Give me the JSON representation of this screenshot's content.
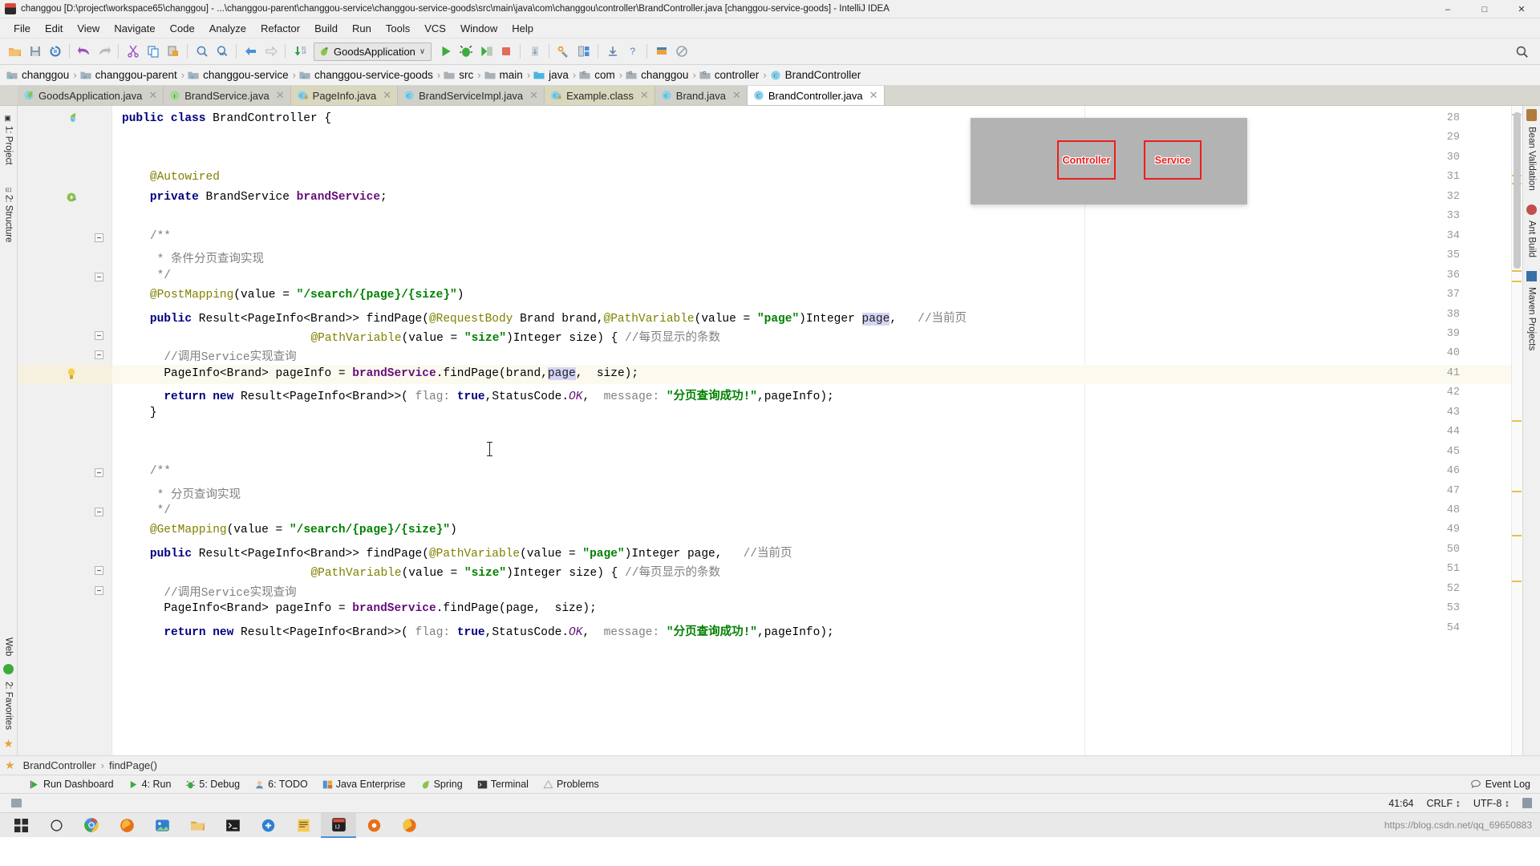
{
  "window": {
    "title": "changgou [D:\\project\\workspace65\\changgou] - ...\\changgou-parent\\changgou-service\\changgou-service-goods\\src\\main\\java\\com\\changgou\\controller\\BrandController.java [changgou-service-goods] - IntelliJ IDEA",
    "minimize": "–",
    "maximize": "□",
    "close": "✕"
  },
  "menu": [
    "File",
    "Edit",
    "View",
    "Navigate",
    "Code",
    "Analyze",
    "Refactor",
    "Build",
    "Run",
    "Tools",
    "VCS",
    "Window",
    "Help"
  ],
  "toolbar": {
    "icons": [
      "open-folder-icon",
      "save-all-icon",
      "sync-icon",
      "undo-icon",
      "redo-icon",
      "cut-icon",
      "copy-icon",
      "paste-icon",
      "find-icon",
      "replace-icon",
      "back-icon",
      "forward-icon",
      "compile-icon"
    ],
    "run_config": "GoodsApplication",
    "run_config_icon": "spring-leaf-icon",
    "dropdown_caret": "∨",
    "actions": [
      "run-icon",
      "debug-icon",
      "run-with-coverage-icon",
      "stop-icon",
      "update-app-icon",
      "settings-icon",
      "project-structure-icon",
      "download-icon",
      "help-icon",
      "load-icon",
      "no-entry-icon"
    ],
    "search_everywhere": "search-icon"
  },
  "breadcrumb": [
    {
      "label": "changgou",
      "icon": "module-folder-icon"
    },
    {
      "label": "changgou-parent",
      "icon": "module-folder-icon"
    },
    {
      "label": "changgou-service",
      "icon": "module-folder-icon"
    },
    {
      "label": "changgou-service-goods",
      "icon": "module-folder-icon"
    },
    {
      "label": "src",
      "icon": "folder-icon"
    },
    {
      "label": "main",
      "icon": "folder-icon"
    },
    {
      "label": "java",
      "icon": "source-folder-icon"
    },
    {
      "label": "com",
      "icon": "package-icon"
    },
    {
      "label": "changgou",
      "icon": "package-icon"
    },
    {
      "label": "controller",
      "icon": "package-icon"
    },
    {
      "label": "BrandController",
      "icon": "class-icon"
    }
  ],
  "tabs": [
    {
      "label": "GoodsApplication.java",
      "icon": "spring-class-icon",
      "style": "normal",
      "active": false,
      "close": "✕"
    },
    {
      "label": "BrandService.java",
      "icon": "interface-icon",
      "style": "normal",
      "active": false,
      "close": "✕"
    },
    {
      "label": "PageInfo.java",
      "icon": "class-locked-icon",
      "style": "cream",
      "active": false,
      "close": "✕"
    },
    {
      "label": "BrandServiceImpl.java",
      "icon": "class-icon",
      "style": "normal",
      "active": false,
      "close": "✕"
    },
    {
      "label": "Example.class",
      "icon": "class-locked-icon",
      "style": "cream",
      "active": false,
      "close": "✕"
    },
    {
      "label": "Brand.java",
      "icon": "class-icon",
      "style": "normal",
      "active": false,
      "close": "✕"
    },
    {
      "label": "BrandController.java",
      "icon": "class-icon",
      "style": "normal",
      "active": true,
      "close": "✕"
    }
  ],
  "left_tool_bars": [
    {
      "label": "1: Project",
      "icon": "project-icon"
    },
    {
      "label": "2: Structure",
      "icon": "structure-icon"
    },
    {
      "label": "Web",
      "icon": "web-icon"
    },
    {
      "label": "2: Favorites",
      "icon": "favorites-icon"
    }
  ],
  "right_tool_bars": [
    {
      "label": "Bean Validation",
      "icon": "bean-icon"
    },
    {
      "label": "Ant Build",
      "icon": "ant-icon"
    },
    {
      "label": "Maven Projects",
      "icon": "maven-icon"
    }
  ],
  "editor": {
    "first_line": 28,
    "lines": [
      {
        "n": 28,
        "gutter": "class-marker-icon",
        "fold": "none",
        "tokens": [
          {
            "t": "public ",
            "c": "kw"
          },
          {
            "t": "class ",
            "c": "kw"
          },
          {
            "t": "BrandController ",
            "c": "plain"
          },
          {
            "t": "{",
            "c": "plain"
          }
        ]
      },
      {
        "n": 29,
        "tokens": []
      },
      {
        "n": 30,
        "tokens": []
      },
      {
        "n": 31,
        "indent": 4,
        "tokens": [
          {
            "t": "@Autowired",
            "c": "ann"
          }
        ]
      },
      {
        "n": 32,
        "indent": 4,
        "gutter": "implemented-icon",
        "tokens": [
          {
            "t": "private ",
            "c": "kw"
          },
          {
            "t": "BrandService ",
            "c": "plain"
          },
          {
            "t": "brandService",
            "c": "fld"
          },
          {
            "t": ";",
            "c": "plain"
          }
        ]
      },
      {
        "n": 33,
        "tokens": []
      },
      {
        "n": 34,
        "indent": 4,
        "fold": "open",
        "tokens": [
          {
            "t": "/**",
            "c": "cmt"
          }
        ]
      },
      {
        "n": 35,
        "indent": 5,
        "tokens": [
          {
            "t": "* 条件分页查询实现",
            "c": "cmt"
          }
        ]
      },
      {
        "n": 36,
        "indent": 5,
        "fold": "close",
        "tokens": [
          {
            "t": "*/",
            "c": "cmt"
          }
        ]
      },
      {
        "n": 37,
        "indent": 4,
        "tokens": [
          {
            "t": "@PostMapping",
            "c": "ann"
          },
          {
            "t": "(value = ",
            "c": "plain"
          },
          {
            "t": "\"/search/{page}/{size}\"",
            "c": "str"
          },
          {
            "t": ")",
            "c": "plain"
          }
        ]
      },
      {
        "n": 38,
        "indent": 4,
        "tokens": [
          {
            "t": "public ",
            "c": "kw"
          },
          {
            "t": "Result<PageInfo<Brand>> findPage(",
            "c": "plain"
          },
          {
            "t": "@RequestBody",
            "c": "ann"
          },
          {
            "t": " Brand brand,",
            "c": "plain"
          },
          {
            "t": "@PathVariable",
            "c": "ann"
          },
          {
            "t": "(value = ",
            "c": "plain"
          },
          {
            "t": "\"page\"",
            "c": "str"
          },
          {
            "t": ")Integer ",
            "c": "plain"
          },
          {
            "t": "page",
            "c": "sel"
          },
          {
            "t": ",   ",
            "c": "plain"
          },
          {
            "t": "//当前页",
            "c": "cmt"
          }
        ]
      },
      {
        "n": 39,
        "indent": 4,
        "fold": "close",
        "pad": 27,
        "tokens": [
          {
            "t": "@PathVariable",
            "c": "ann"
          },
          {
            "t": "(value = ",
            "c": "plain"
          },
          {
            "t": "\"size\"",
            "c": "str"
          },
          {
            "t": ")Integer size) { ",
            "c": "plain"
          },
          {
            "t": "//每页显示的条数",
            "c": "cmt"
          }
        ]
      },
      {
        "n": 40,
        "indent": 6,
        "fold": "open",
        "tokens": [
          {
            "t": "//调用Service实现查询",
            "c": "cmt"
          }
        ]
      },
      {
        "n": 41,
        "indent": 6,
        "highlight": true,
        "gutter": "intention-bulb-icon",
        "tokens": [
          {
            "t": "PageInfo<Brand> pageInfo = ",
            "c": "plain"
          },
          {
            "t": "brandService",
            "c": "fld"
          },
          {
            "t": ".findPage(brand,",
            "c": "plain"
          },
          {
            "t": "page",
            "c": "sel"
          },
          {
            "t": ",  size);",
            "c": "plain"
          }
        ]
      },
      {
        "n": 42,
        "indent": 6,
        "tokens": [
          {
            "t": "return ",
            "c": "kw"
          },
          {
            "t": "new ",
            "c": "kw"
          },
          {
            "t": "Result<PageInfo<Brand>>(",
            "c": "plain"
          },
          {
            "t": " flag: ",
            "c": "param"
          },
          {
            "t": "true",
            "c": "kw"
          },
          {
            "t": ",StatusCode.",
            "c": "plain"
          },
          {
            "t": "OK",
            "c": "sfld"
          },
          {
            "t": ",  ",
            "c": "plain"
          },
          {
            "t": "message: ",
            "c": "param"
          },
          {
            "t": "\"分页查询成功!\"",
            "c": "str"
          },
          {
            "t": ",pageInfo);",
            "c": "plain"
          }
        ]
      },
      {
        "n": 43,
        "indent": 4,
        "tokens": [
          {
            "t": "}",
            "c": "plain"
          }
        ]
      },
      {
        "n": 44,
        "tokens": []
      },
      {
        "n": 45,
        "tokens": []
      },
      {
        "n": 46,
        "indent": 4,
        "fold": "open",
        "tokens": [
          {
            "t": "/**",
            "c": "cmt"
          }
        ]
      },
      {
        "n": 47,
        "indent": 5,
        "tokens": [
          {
            "t": "* 分页查询实现",
            "c": "cmt"
          }
        ]
      },
      {
        "n": 48,
        "indent": 5,
        "fold": "close",
        "tokens": [
          {
            "t": "*/",
            "c": "cmt"
          }
        ]
      },
      {
        "n": 49,
        "indent": 4,
        "tokens": [
          {
            "t": "@GetMapping",
            "c": "ann"
          },
          {
            "t": "(value = ",
            "c": "plain"
          },
          {
            "t": "\"/search/{page}/{size}\"",
            "c": "str"
          },
          {
            "t": ")",
            "c": "plain"
          }
        ]
      },
      {
        "n": 50,
        "indent": 4,
        "tokens": [
          {
            "t": "public ",
            "c": "kw"
          },
          {
            "t": "Result<PageInfo<Brand>> findPage(",
            "c": "plain"
          },
          {
            "t": "@PathVariable",
            "c": "ann"
          },
          {
            "t": "(value = ",
            "c": "plain"
          },
          {
            "t": "\"page\"",
            "c": "str"
          },
          {
            "t": ")Integer page,   ",
            "c": "plain"
          },
          {
            "t": "//当前页",
            "c": "cmt"
          }
        ]
      },
      {
        "n": 51,
        "indent": 4,
        "fold": "close",
        "pad": 27,
        "tokens": [
          {
            "t": "@PathVariable",
            "c": "ann"
          },
          {
            "t": "(value = ",
            "c": "plain"
          },
          {
            "t": "\"size\"",
            "c": "str"
          },
          {
            "t": ")Integer size) { ",
            "c": "plain"
          },
          {
            "t": "//每页显示的条数",
            "c": "cmt"
          }
        ]
      },
      {
        "n": 52,
        "indent": 6,
        "fold": "open",
        "tokens": [
          {
            "t": "//调用Service实现查询",
            "c": "cmt"
          }
        ]
      },
      {
        "n": 53,
        "indent": 6,
        "tokens": [
          {
            "t": "PageInfo<Brand> pageInfo = ",
            "c": "plain"
          },
          {
            "t": "brandService",
            "c": "fld"
          },
          {
            "t": ".findPage(page,  size);",
            "c": "plain"
          }
        ]
      },
      {
        "n": 54,
        "indent": 6,
        "tokens": [
          {
            "t": "return ",
            "c": "kw"
          },
          {
            "t": "new ",
            "c": "kw"
          },
          {
            "t": "Result<PageInfo<Brand>>(",
            "c": "plain"
          },
          {
            "t": " flag: ",
            "c": "param"
          },
          {
            "t": "true",
            "c": "kw"
          },
          {
            "t": ",StatusCode.",
            "c": "plain"
          },
          {
            "t": "OK",
            "c": "sfld"
          },
          {
            "t": ",  ",
            "c": "plain"
          },
          {
            "t": "message: ",
            "c": "param"
          },
          {
            "t": "\"分页查询成功!\"",
            "c": "str"
          },
          {
            "t": ",pageInfo);",
            "c": "plain"
          }
        ]
      }
    ]
  },
  "overlay": {
    "boxes": [
      {
        "label": "Controller"
      },
      {
        "label": "Service"
      }
    ],
    "box_color": "#ef1d1d",
    "panel_color": "#b3b3b3"
  },
  "nav": {
    "class": "BrandController",
    "separator": "›",
    "method": "findPage()"
  },
  "toolwindows": [
    {
      "label": "Run Dashboard",
      "icon": "run-dashboard-icon"
    },
    {
      "label": "4: Run",
      "icon": "run-icon"
    },
    {
      "label": "5: Debug",
      "icon": "debug-icon"
    },
    {
      "label": "6: TODO",
      "icon": "todo-icon"
    },
    {
      "label": "Java Enterprise",
      "icon": "java-ee-icon"
    },
    {
      "label": "Spring",
      "icon": "spring-leaf-icon"
    },
    {
      "label": "Terminal",
      "icon": "terminal-icon"
    },
    {
      "label": "Problems",
      "icon": "problems-icon"
    }
  ],
  "event_log": {
    "label": "Event Log",
    "icon": "event-log-icon"
  },
  "status": {
    "caret": "41:64",
    "line_separator": "CRLF ↕",
    "encoding": "UTF-8 ↕",
    "lock_icon": "lock-icon"
  },
  "taskbar": {
    "items": [
      "windows-start-icon",
      "cortana-search-icon",
      "chrome-icon",
      "firefox-dev-icon",
      "photos-icon",
      "explorer-icon",
      "terminal-icon",
      "tool-icon",
      "notepad-icon",
      "idea-icon",
      "xmind-icon",
      "browser-icon"
    ],
    "watermark": "https://blog.csdn.net/qq_69650883"
  },
  "colors": {
    "accent": "#4a90d9",
    "chrome": "#f0f0f0",
    "tab_bg": "#d7d7cf",
    "tab_cream": "#d9d7bd",
    "highlight_line": "#fcfaef",
    "selection": "#d4d4f5"
  }
}
